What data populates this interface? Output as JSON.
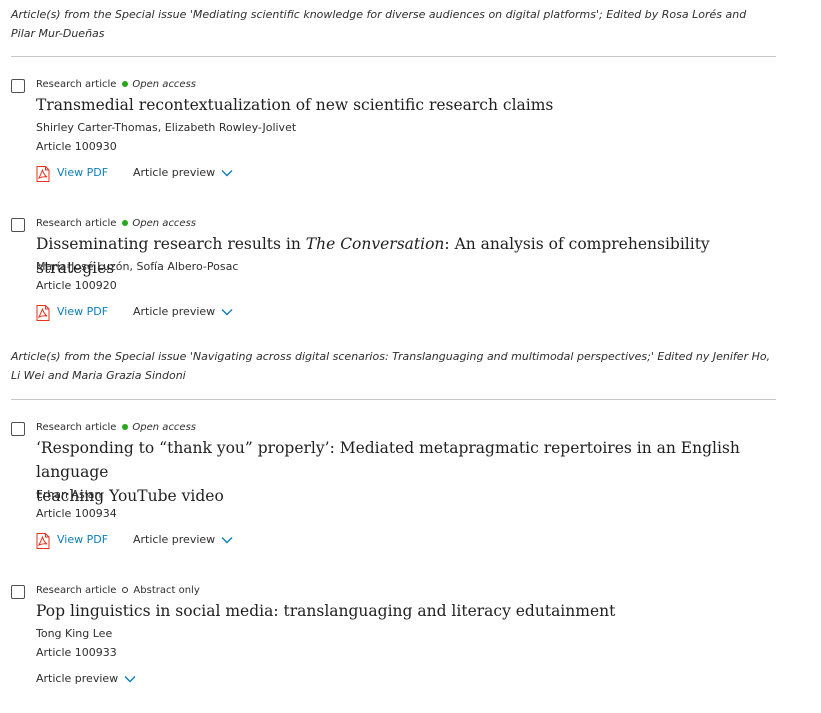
{
  "sections": [
    {
      "note": "Article(s) from the Special issue 'Mediating scientific knowledge for diverse audiences on digital platforms'; Edited by Rosa Lorés and Pilar Mur-Dueñas"
    },
    {
      "note": "Article(s) from the Special issue 'Navigating across digital scenarios: Translanguaging and multimodal perspectives;' Edited ny Jenifer Ho, Li Wei and Maria Grazia Sindoni"
    }
  ],
  "articles": [
    {
      "type": "Research article",
      "access": "Open access",
      "title": "Transmedial recontextualization of new scientific research claims",
      "authors": "Shirley Carter-Thomas, Elizabeth Rowley-Jolivet",
      "article_no": "Article 100930",
      "pdf_label": "View PDF",
      "preview_label": "Article preview"
    },
    {
      "type": "Research article",
      "access": "Open access",
      "title_prefix": "Disseminating research results in ",
      "title_italic": "The Conversation",
      "title_suffix": ": An analysis of comprehensibility strategies",
      "authors": "María-José Luzón, Sofía Albero-Posac",
      "article_no": "Article 100920",
      "pdf_label": "View PDF",
      "preview_label": "Article preview"
    },
    {
      "type": "Research article",
      "access": "Open access",
      "title_line1": "‘Responding to “thank you” properly’: Mediated metapragmatic repertoires in an English language",
      "title_line2": "teaching YouTube video",
      "authors": "Erhan Aslan",
      "article_no": "Article 100934",
      "pdf_label": "View PDF",
      "preview_label": "Article preview"
    },
    {
      "type": "Research article",
      "access": "Abstract only",
      "title": "Pop linguistics in social media: translanguaging and literacy edutainment",
      "authors": "Tong King Lee",
      "article_no": "Article 100933",
      "preview_label": "Article preview"
    }
  ],
  "colors": {
    "link": "#0c7dbb",
    "open_access_dot": "#29a61b",
    "divider": "#c6c6c6",
    "pdf_icon": "#e9321e"
  },
  "icons": [
    "pdf-icon",
    "chevron-down-icon",
    "checkbox",
    "open-access-dot",
    "abstract-only-ring"
  ]
}
